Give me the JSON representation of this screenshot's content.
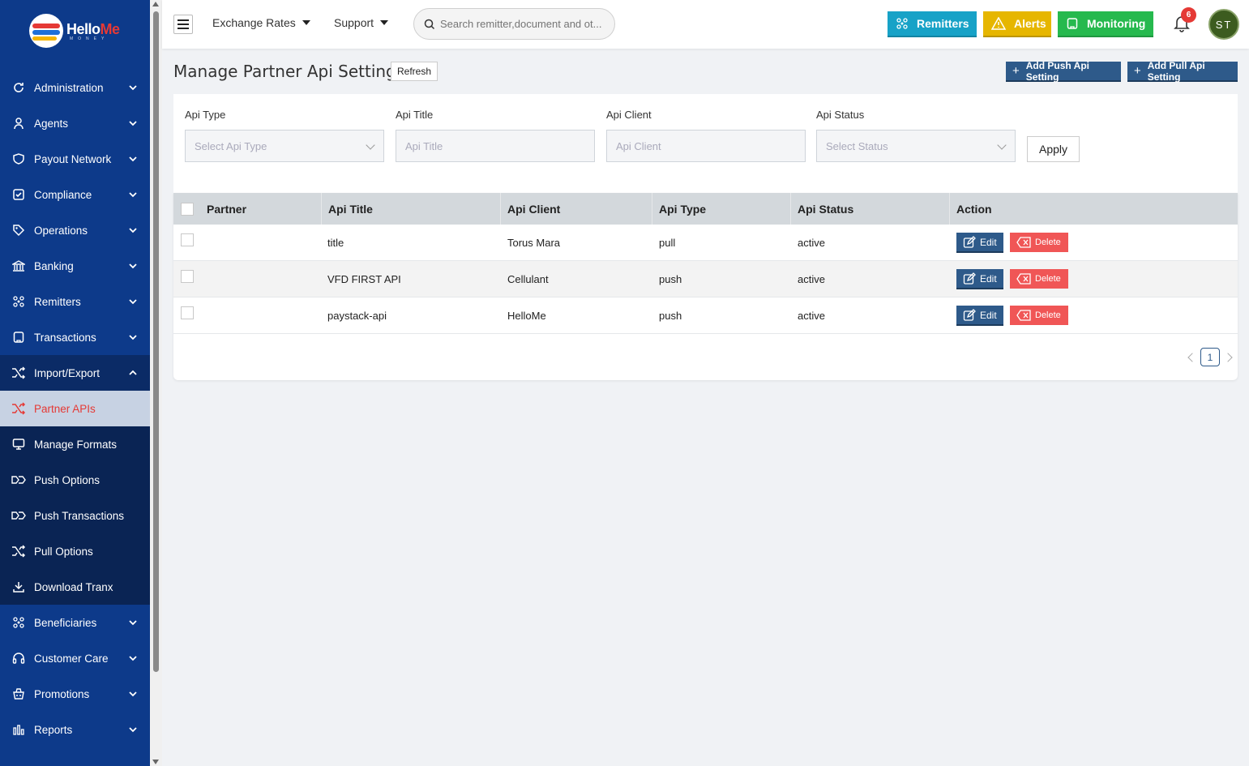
{
  "brand": {
    "name_part1": "Hello",
    "name_part2": "Me",
    "tagline": "MONEY"
  },
  "sidebar": {
    "items": [
      {
        "label": "Administration",
        "icon": "refresh-icon"
      },
      {
        "label": "Agents",
        "icon": "user-icon"
      },
      {
        "label": "Payout Network",
        "icon": "shield-icon"
      },
      {
        "label": "Compliance",
        "icon": "check-square-icon"
      },
      {
        "label": "Operations",
        "icon": "tag-icon"
      },
      {
        "label": "Banking",
        "icon": "bank-icon"
      },
      {
        "label": "Remitters",
        "icon": "network-icon"
      },
      {
        "label": "Transactions",
        "icon": "receipt-icon"
      },
      {
        "label": "Import/Export",
        "icon": "shuffle-icon"
      }
    ],
    "subitems": [
      {
        "label": "Partner APIs",
        "icon": "shuffle-icon",
        "active": true
      },
      {
        "label": "Manage Formats",
        "icon": "monitor-icon"
      },
      {
        "label": "Push Options",
        "icon": "push-icon"
      },
      {
        "label": "Push Transactions",
        "icon": "push-icon"
      },
      {
        "label": "Pull Options",
        "icon": "shuffle-icon"
      },
      {
        "label": "Download Tranx",
        "icon": "download-icon"
      }
    ],
    "items_after": [
      {
        "label": "Beneficiaries",
        "icon": "network-icon"
      },
      {
        "label": "Customer Care",
        "icon": "headset-icon"
      },
      {
        "label": "Promotions",
        "icon": "basket-icon"
      },
      {
        "label": "Reports",
        "icon": "bar-chart-icon"
      }
    ]
  },
  "topbar": {
    "exchange_rates": "Exchange Rates",
    "support": "Support",
    "search_placeholder": "Search remitter,document and ot...",
    "remitters_btn": "Remitters",
    "alerts_btn": "Alerts",
    "monitoring_btn": "Monitoring",
    "notification_count": "6",
    "avatar_initials": "ST",
    "colors": {
      "remitters": "#17a2c7",
      "alerts": "#e6b600",
      "monitoring": "#26b94e"
    }
  },
  "page": {
    "title": "Manage Partner Api Settings",
    "refresh_label": "Refresh",
    "add_push_label": "Add Push Api Setting",
    "add_pull_label": "Add Pull Api Setting"
  },
  "filters": {
    "api_type_label": "Api Type",
    "api_type_placeholder": "Select Api Type",
    "api_title_label": "Api Title",
    "api_title_placeholder": "Api Title",
    "api_client_label": "Api Client",
    "api_client_placeholder": "Api Client",
    "api_status_label": "Api Status",
    "api_status_placeholder": "Select Status",
    "apply_label": "Apply"
  },
  "table": {
    "headers": {
      "partner": "Partner",
      "api_title": "Api Title",
      "api_client": "Api Client",
      "api_type": "Api Type",
      "api_status": "Api Status",
      "action": "Action"
    },
    "rows": [
      {
        "partner": "",
        "api_title": "title",
        "api_client": "Torus Mara",
        "api_type": "pull",
        "api_status": "active"
      },
      {
        "partner": "",
        "api_title": "VFD FIRST API",
        "api_client": "Cellulant",
        "api_type": "push",
        "api_status": "active"
      },
      {
        "partner": "",
        "api_title": "paystack-api",
        "api_client": "HelloMe",
        "api_type": "push",
        "api_status": "active"
      }
    ],
    "edit_label": "Edit",
    "delete_label": "Delete",
    "current_page": "1"
  }
}
